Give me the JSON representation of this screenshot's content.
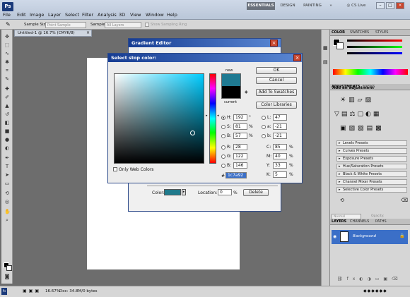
{
  "app": {
    "logo": "Ps",
    "menu": [
      "File",
      "Edit",
      "Image",
      "Layer",
      "Select",
      "Filter",
      "Analysis",
      "3D",
      "View",
      "Window",
      "Help"
    ],
    "workspaces": [
      "ESSENTIALS",
      "DESIGN",
      "PAINTING"
    ],
    "more": "»",
    "cs_live": "CS Live",
    "window_buttons": [
      "–",
      "□",
      "×"
    ]
  },
  "options": {
    "sample_size_label": "Sample Size:",
    "sample_size_value": "Point Sample",
    "sample_label": "Sample:",
    "sample_value": "All Layers",
    "show_ring": "Show Sampling Ring"
  },
  "document": {
    "tab": "Untitled-1 @ 16.7% (CMYK/8)",
    "close": "×"
  },
  "status": {
    "zoom": "16.67%",
    "doc_info": "Doc: 34.8M/0 bytes"
  },
  "gradient_editor": {
    "title": "Gradient Editor",
    "color_label": "Color:",
    "location_label": "Location:",
    "location_value": "0",
    "percent": "%",
    "delete": "Delete",
    "stop_color": "#1f7a8c"
  },
  "picker": {
    "title": "Select stop color:",
    "new_label": "new",
    "current_label": "current",
    "new_color": "#1f7a92",
    "current_color": "#000000",
    "ok": "OK",
    "cancel": "Cancel",
    "add_swatches": "Add To Swatches",
    "color_libraries": "Color Libraries",
    "only_web": "Only Web Colors",
    "hex": "1c7a92",
    "fields": {
      "H": "192",
      "S": "81",
      "B": "57",
      "R": "28",
      "G": "122",
      "B2": "146",
      "L": "47",
      "a": "-21",
      "b": "-21",
      "C": "85",
      "M": "40",
      "Y": "33",
      "K": "5"
    },
    "units": {
      "deg": "°",
      "pct": "%"
    }
  },
  "panels": {
    "color_tabs": [
      "COLOR",
      "SWATCHES",
      "STYLES"
    ],
    "adj_tabs": [
      "ADJUSTMENTS",
      "MASKS"
    ],
    "add_adjustment": "Add an adjustment",
    "presets": [
      "Levels Presets",
      "Curves Presets",
      "Exposure Presets",
      "Hue/Saturation Presets",
      "Black & White Presets",
      "Channel Mixer Presets",
      "Selective Color Presets"
    ],
    "layer_tabs": [
      "LAYERS",
      "CHANNELS",
      "PATHS"
    ],
    "blend_mode": "Normal",
    "opacity": "Opacity:",
    "layer_name": "Background"
  }
}
